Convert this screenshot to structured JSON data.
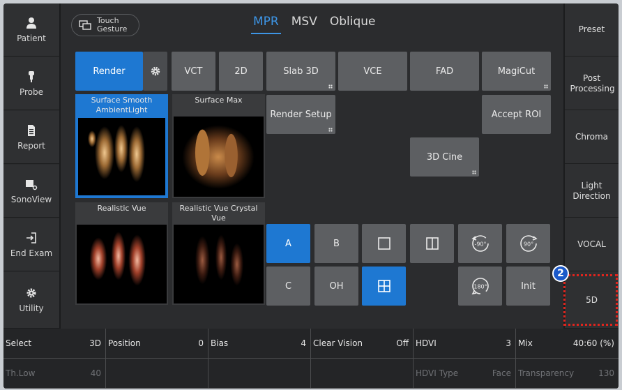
{
  "left_sidebar": {
    "items": [
      {
        "label": "Patient",
        "icon": "person-icon"
      },
      {
        "label": "Probe",
        "icon": "probe-icon"
      },
      {
        "label": "Report",
        "icon": "document-icon"
      },
      {
        "label": "SonoView",
        "icon": "sonoview-icon"
      },
      {
        "label": "End Exam",
        "icon": "exit-icon"
      },
      {
        "label": "Utility",
        "icon": "gear-icon"
      }
    ]
  },
  "right_sidebar": {
    "items": [
      "Preset",
      "Post Processing",
      "Chroma",
      "Light Direction",
      "VOCAL",
      "5D"
    ]
  },
  "header": {
    "touch_gesture": "Touch Gesture",
    "tabs": [
      "MPR",
      "MSV",
      "Oblique"
    ],
    "active_tab": "MPR"
  },
  "render": {
    "render_label": "Render",
    "vct": "VCT",
    "two_d": "2D",
    "slab_3d": "Slab 3D",
    "vce": "VCE",
    "fad": "FAD",
    "magicut": "MagiCut",
    "render_setup": "Render Setup",
    "accept_roi": "Accept ROI",
    "cine_3d": "3D Cine"
  },
  "thumbnails": [
    {
      "label": "Surface Smooth AmbientLight",
      "selected": true
    },
    {
      "label": "Surface Max",
      "selected": false
    },
    {
      "label": "Realistic Vue",
      "selected": false
    },
    {
      "label": "Realistic Vue Crystal Vue",
      "selected": false
    }
  ],
  "view_controls": {
    "a": "A",
    "b": "B",
    "c": "C",
    "oh": "OH",
    "rot_minus_90": "-90°",
    "rot_90": "90°",
    "rot_180": "180°",
    "init": "Init"
  },
  "params": {
    "row1": [
      {
        "name": "Select",
        "value": "3D"
      },
      {
        "name": "Position",
        "value": "0"
      },
      {
        "name": "Bias",
        "value": "4"
      },
      {
        "name": "Clear Vision",
        "value": "Off"
      },
      {
        "name": "HDVI",
        "value": "3"
      },
      {
        "name": "Mix",
        "value": "40:60 (%)"
      }
    ],
    "row2": [
      {
        "name": "Th.Low",
        "value": "40"
      },
      {
        "name": "",
        "value": ""
      },
      {
        "name": "",
        "value": ""
      },
      {
        "name": "",
        "value": ""
      },
      {
        "name": "HDVI Type",
        "value": "Face"
      },
      {
        "name": "Transparency",
        "value": "130"
      }
    ]
  },
  "annotation": {
    "badge": "2"
  },
  "colors": {
    "accent": "#1e78d2",
    "tab_active": "#3d95e6",
    "button": "#5d5f62",
    "annotation": "#e2241d"
  }
}
